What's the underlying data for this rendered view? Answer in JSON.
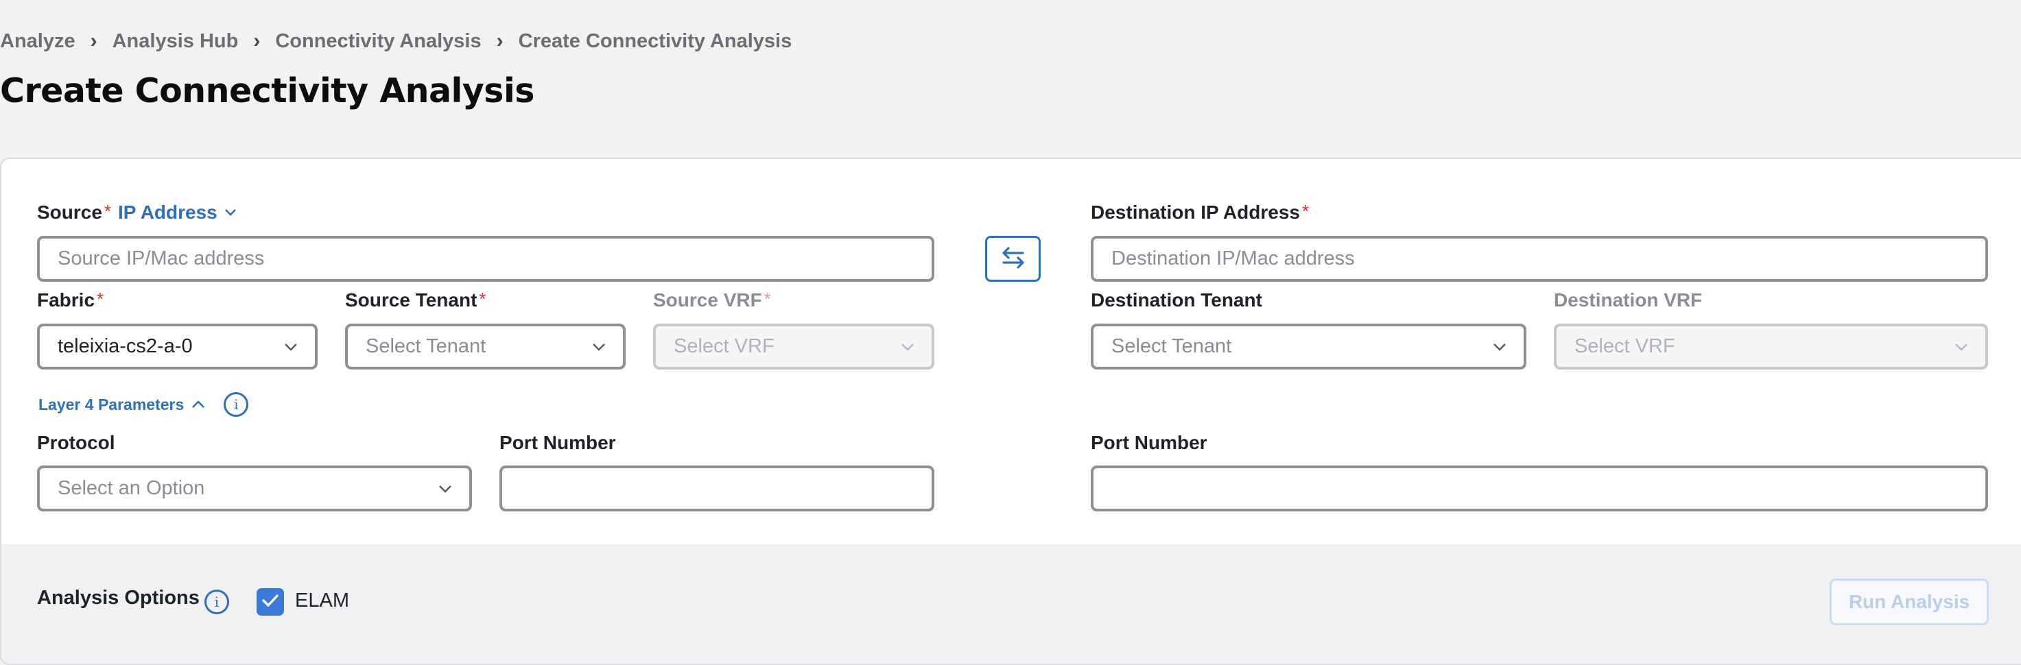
{
  "breadcrumb": [
    "Analyze",
    "Analysis Hub",
    "Connectivity Analysis",
    "Create Connectivity Analysis"
  ],
  "breadcrumb_separator": "›",
  "page_title": "Create Connectivity Analysis",
  "source": {
    "label": "Source",
    "type_selector": "IP Address",
    "input_placeholder": "Source IP/Mac address",
    "fabric_label": "Fabric",
    "fabric_value": "teleixia-cs2-a-0",
    "tenant_label": "Source Tenant",
    "tenant_placeholder": "Select Tenant",
    "vrf_label": "Source VRF",
    "vrf_placeholder": "Select VRF"
  },
  "destination": {
    "label": "Destination IP Address",
    "input_placeholder": "Destination IP/Mac address",
    "tenant_label": "Destination Tenant",
    "tenant_placeholder": "Select Tenant",
    "vrf_label": "Destination VRF",
    "vrf_placeholder": "Select VRF"
  },
  "required_marker": "*",
  "layer4": {
    "toggle_label": "Layer 4 Parameters",
    "protocol_label": "Protocol",
    "protocol_placeholder": "Select an Option",
    "source_port_label": "Port Number",
    "destination_port_label": "Port Number"
  },
  "analysis_options": {
    "label": "Analysis Options",
    "elam_label": "ELAM",
    "elam_checked": true
  },
  "run_button": "Run Analysis",
  "info_glyph": "i",
  "colors": {
    "accent": "#2f6fbf",
    "checkbox": "#3b7ad8",
    "required": "#d0342c",
    "disabled_button_text": "#b8cfec"
  }
}
